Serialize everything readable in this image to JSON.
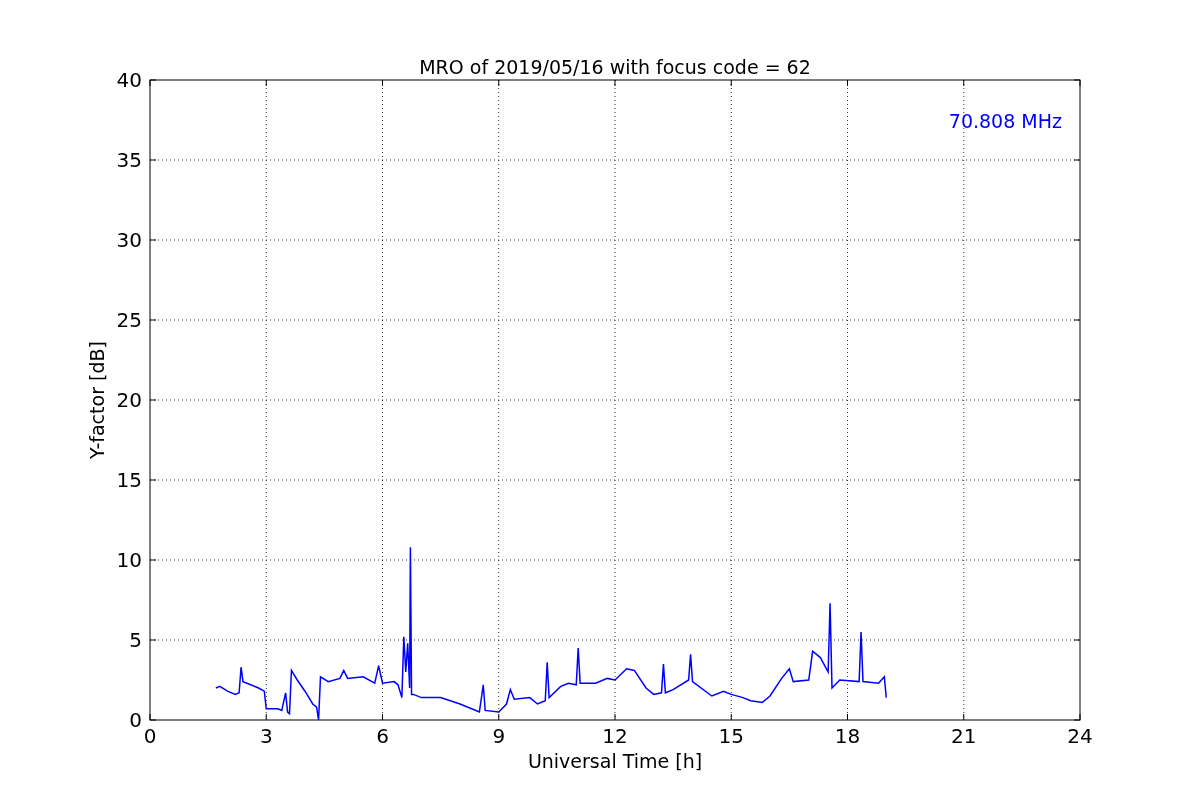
{
  "chart_data": {
    "type": "line",
    "title": "MRO of 2019/05/16 with focus code = 62",
    "xlabel": "Universal Time [h]",
    "ylabel": "Y-factor [dB]",
    "x": [
      1.7,
      1.8,
      2.0,
      2.2,
      2.3,
      2.35,
      2.4,
      2.6,
      2.8,
      2.95,
      3.0,
      3.3,
      3.4,
      3.5,
      3.55,
      3.6,
      3.65,
      3.8,
      4.0,
      4.2,
      4.3,
      4.35,
      4.4,
      4.6,
      4.9,
      5.0,
      5.1,
      5.5,
      5.8,
      5.9,
      6.0,
      6.3,
      6.4,
      6.5,
      6.55,
      6.6,
      6.65,
      6.7,
      6.72,
      6.75,
      6.8,
      7.0,
      7.5,
      8.0,
      8.3,
      8.5,
      8.6,
      8.65,
      9.0,
      9.2,
      9.3,
      9.4,
      9.8,
      10.0,
      10.2,
      10.25,
      10.3,
      10.6,
      10.8,
      11.0,
      11.05,
      11.1,
      11.5,
      11.8,
      12.0,
      12.3,
      12.5,
      12.8,
      13.0,
      13.2,
      13.25,
      13.3,
      13.5,
      13.9,
      13.95,
      14.0,
      14.5,
      14.8,
      15.0,
      15.3,
      15.5,
      15.8,
      16.0,
      16.3,
      16.5,
      16.6,
      17.0,
      17.1,
      17.3,
      17.5,
      17.55,
      17.6,
      17.8,
      18.3,
      18.35,
      18.4,
      18.8,
      18.95,
      19.0
    ],
    "series": [
      {
        "name": "70.808 MHz",
        "color": "#0000ff",
        "values": [
          2.0,
          2.1,
          1.8,
          1.6,
          1.7,
          3.3,
          2.4,
          2.2,
          2.0,
          1.8,
          0.7,
          0.7,
          0.6,
          1.7,
          0.5,
          0.4,
          3.1,
          2.5,
          1.8,
          1.0,
          0.8,
          0.0,
          2.7,
          2.4,
          2.6,
          3.1,
          2.6,
          2.7,
          2.3,
          3.4,
          2.3,
          2.4,
          2.2,
          1.4,
          5.2,
          3.0,
          4.8,
          2.0,
          10.8,
          1.6,
          1.6,
          1.4,
          1.4,
          1.0,
          0.7,
          0.5,
          2.2,
          0.6,
          0.5,
          1.0,
          1.9,
          1.3,
          1.4,
          1.0,
          1.2,
          3.6,
          1.4,
          2.1,
          2.3,
          2.2,
          4.5,
          2.3,
          2.3,
          2.6,
          2.5,
          3.2,
          3.1,
          2.0,
          1.6,
          1.7,
          3.5,
          1.7,
          1.9,
          2.5,
          4.1,
          2.4,
          1.5,
          1.8,
          1.6,
          1.4,
          1.2,
          1.1,
          1.5,
          2.6,
          3.2,
          2.4,
          2.5,
          4.3,
          3.9,
          3.0,
          7.3,
          2.0,
          2.5,
          2.4,
          5.5,
          2.4,
          2.3,
          2.7,
          1.4
        ]
      }
    ],
    "grid": true,
    "xlim": [
      0,
      24
    ],
    "ylim": [
      0,
      40
    ],
    "xticks": [
      0,
      3,
      6,
      9,
      12,
      15,
      18,
      21,
      24
    ],
    "yticks": [
      0,
      5,
      10,
      15,
      20,
      25,
      30,
      35,
      40
    ]
  }
}
